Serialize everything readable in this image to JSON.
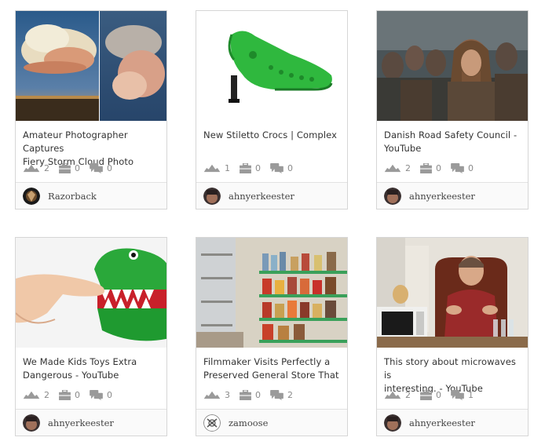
{
  "cards": [
    {
      "title_line1": "Amateur Photographer Captures",
      "title_line2": "Fiery Storm Cloud Photo",
      "likes": "2",
      "collections": "0",
      "comments": "0",
      "user": "Razorback",
      "image": "storm-cloud-photo"
    },
    {
      "title_line1": "New Stiletto Crocs | Complex",
      "title_line2": "",
      "likes": "1",
      "collections": "0",
      "comments": "0",
      "user": "ahnyerkeester",
      "image": "green-stiletto-croc"
    },
    {
      "title_line1": "Danish Road Safety Council -",
      "title_line2": "YouTube",
      "likes": "2",
      "collections": "0",
      "comments": "0",
      "user": "ahnyerkeester",
      "image": "viking-crowd"
    },
    {
      "title_line1": "We Made Kids Toys Extra",
      "title_line2": "Dangerous - YouTube",
      "likes": "2",
      "collections": "0",
      "comments": "0",
      "user": "ahnyerkeester",
      "image": "crocodile-dentist-toy"
    },
    {
      "title_line1": "Filmmaker Visits Perfectly a",
      "title_line2": "Preserved General Store That",
      "likes": "3",
      "collections": "0",
      "comments": "2",
      "user": "zamoose",
      "image": "general-store-shelves"
    },
    {
      "title_line1": "This story about microwaves is",
      "title_line2": "interesting. - YouTube",
      "likes": "2",
      "collections": "0",
      "comments": "1",
      "user": "ahnyerkeester",
      "image": "man-with-microwave"
    }
  ],
  "icons": {
    "like": "like-icon",
    "collection": "briefcase-icon",
    "comment": "comment-icon"
  },
  "colors": {
    "icon_gray": "#9a9a9a",
    "title_text": "#333333",
    "border": "#d6d6d6"
  }
}
